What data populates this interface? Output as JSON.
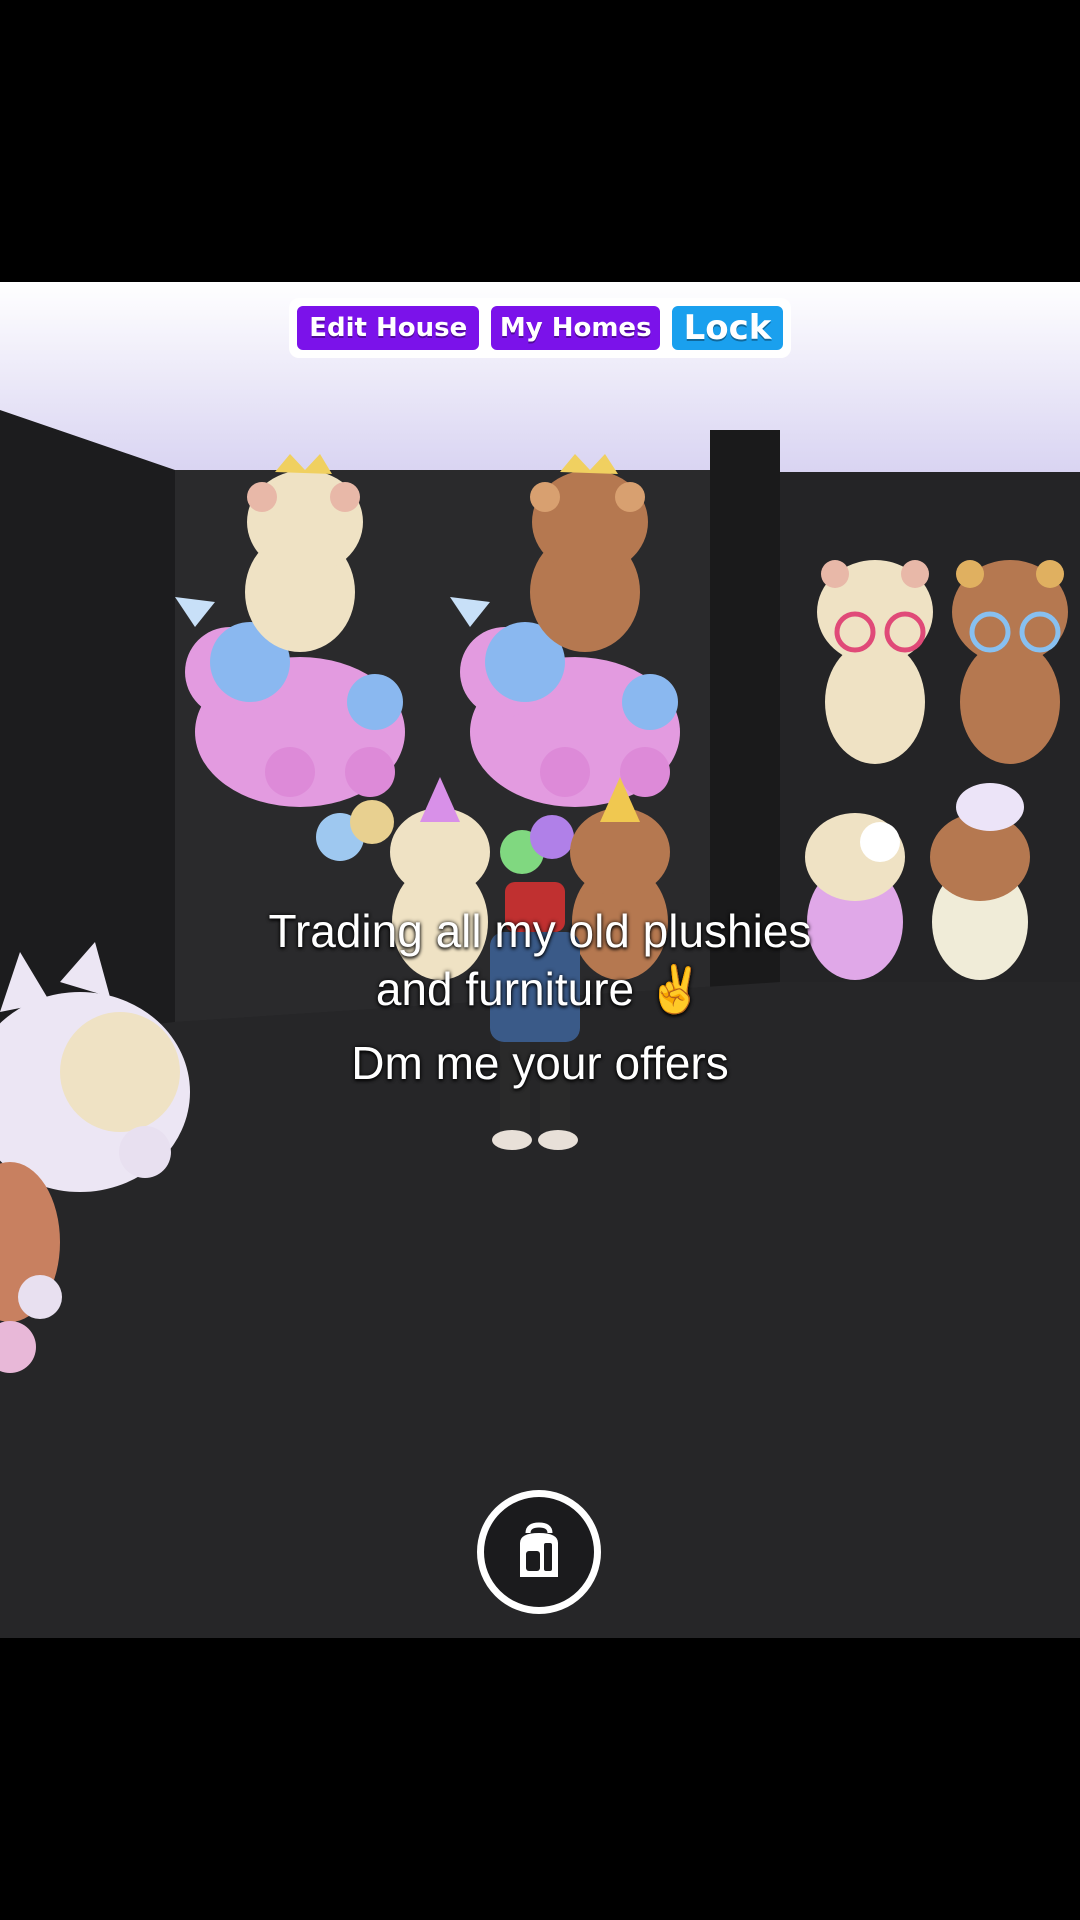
{
  "toolbar": {
    "edit_house": "Edit House",
    "my_homes": "My Homes",
    "lock": "Lock"
  },
  "caption": {
    "line1": "Trading all my old plushies",
    "line2": "and furniture ✌️",
    "line3": "Dm me your offers"
  },
  "icons": {
    "backpack": "backpack-icon"
  },
  "colors": {
    "edit_button": "#7b12ea",
    "homes_button": "#7b12ea",
    "lock_button": "#1aa0ee",
    "ceiling": "#e8e6f6",
    "floor": "#262628"
  }
}
